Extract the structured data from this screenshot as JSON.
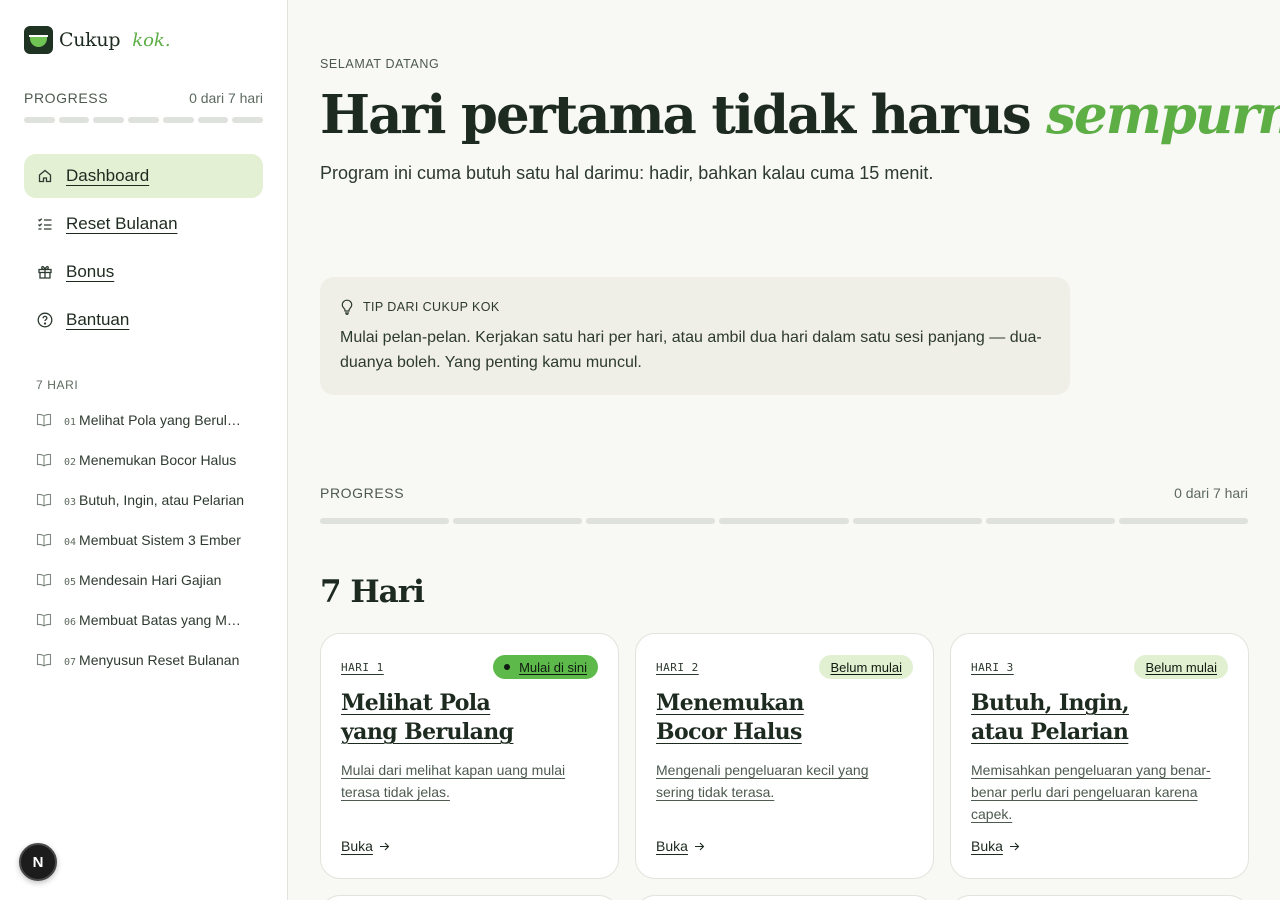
{
  "brand": {
    "name": "Cukup",
    "tagline": "kok."
  },
  "sidebar": {
    "progress": {
      "label": "PROGRESS",
      "count": "0 dari 7 hari",
      "completed": 0,
      "total": 7
    },
    "nav": [
      {
        "label": "Dashboard",
        "icon": "home-icon",
        "active": true
      },
      {
        "label": "Reset Bulanan",
        "icon": "checklist-icon",
        "active": false
      },
      {
        "label": "Bonus",
        "icon": "gift-icon",
        "active": false
      },
      {
        "label": "Bantuan",
        "icon": "help-circle-icon",
        "active": false
      }
    ],
    "days_title": "7 HARI",
    "days": [
      {
        "num": "01",
        "title": "Melihat Pola yang Berulang"
      },
      {
        "num": "02",
        "title": "Menemukan Bocor Halus"
      },
      {
        "num": "03",
        "title": "Butuh, Ingin, atau Pelarian"
      },
      {
        "num": "04",
        "title": "Membuat Sistem 3 Ember"
      },
      {
        "num": "05",
        "title": "Mendesain Hari Gajian"
      },
      {
        "num": "06",
        "title": "Membuat Batas yang Masuk Akal"
      },
      {
        "num": "07",
        "title": "Menyusun Reset Bulanan"
      }
    ]
  },
  "main": {
    "eyebrow": "SELAMAT DATANG",
    "hero_plain": "Hari pertama tidak harus ",
    "hero_accent": "sempurna",
    "hero_end": ".",
    "subtitle": "Program ini cuma butuh satu hal darimu: hadir, bahkan kalau cuma 15 menit.",
    "tip": {
      "title": "TIP DARI CUKUP KOK",
      "icon": "lightbulb-icon",
      "body": "Mulai pelan-pelan. Kerjakan satu hari per hari, atau ambil dua hari dalam satu sesi panjang — dua-duanya boleh. Yang penting kamu muncul."
    },
    "progress": {
      "label": "PROGRESS",
      "count": "0 dari 7 hari",
      "completed": 0,
      "total": 7
    },
    "section_title": "7 Hari",
    "cards": [
      {
        "day": "HARI 1",
        "status": "Mulai di sini",
        "status_type": "start",
        "title_line1": "Melihat Pola",
        "title_line2": "yang Berulang",
        "desc": "Mulai dari melihat kapan uang mulai terasa tidak jelas.",
        "open": "Buka"
      },
      {
        "day": "HARI 2",
        "status": "Belum mulai",
        "status_type": "pending",
        "title_line1": "Menemukan",
        "title_line2": "Bocor Halus",
        "desc": "Mengenali pengeluaran kecil yang sering tidak terasa.",
        "open": "Buka"
      },
      {
        "day": "HARI 3",
        "status": "Belum mulai",
        "status_type": "pending",
        "title_line1": "Butuh, Ingin,",
        "title_line2": "atau Pelarian",
        "desc": "Memisahkan pengeluaran yang benar-benar perlu dari pengeluaran karena capek.",
        "open": "Buka"
      }
    ]
  },
  "floating_badge": "N",
  "colors": {
    "accent": "#5cae45",
    "active_nav_bg": "#e3f0d4",
    "dark": "#1d2a1f",
    "pill_start": "#5cb94a",
    "pill_pending": "#e2f0d2"
  }
}
